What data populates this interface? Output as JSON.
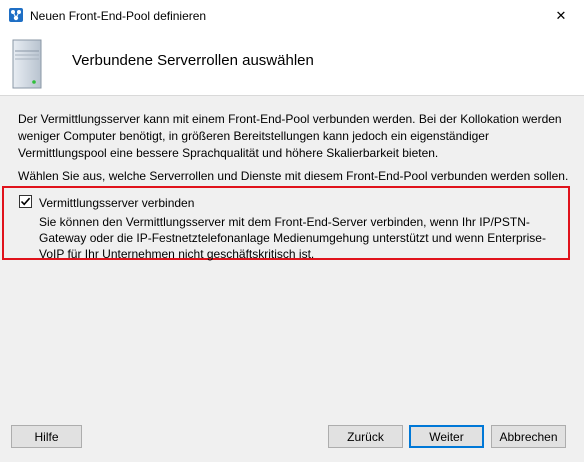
{
  "window": {
    "title": "Neuen Front-End-Pool definieren",
    "close_glyph": "✕"
  },
  "header": {
    "title": "Verbundene Serverrollen auswählen"
  },
  "main": {
    "intro": "Der Vermittlungsserver kann mit einem Front-End-Pool verbunden werden. Bei der Kollokation werden weniger Computer benötigt, in größeren Bereitstellungen kann jedoch ein eigenständiger Vermittlungspool eine bessere Sprachqualität und höhere Skalierbarkeit bieten.",
    "prompt": "Wählen Sie aus, welche Serverrollen und Dienste mit diesem Front-End-Pool verbunden werden sollen.",
    "option": {
      "label": "Vermittlungsserver verbinden",
      "checked": true,
      "description": "Sie können den Vermittlungsserver mit dem Front-End-Server verbinden, wenn Ihr IP/PSTN-Gateway oder die IP-Festnetztelefonanlage Medienumgehung unterstützt und wenn Enterprise-VoIP für Ihr Unternehmen nicht geschäftskritisch ist."
    }
  },
  "footer": {
    "help": "Hilfe",
    "back": "Zurück",
    "next": "Weiter",
    "cancel": "Abbrechen"
  },
  "colors": {
    "highlight_border": "#e0121b",
    "default_button_border": "#0078d7"
  },
  "icons": [
    "app-icon",
    "server-icon",
    "close-icon",
    "checkmark-icon"
  ]
}
